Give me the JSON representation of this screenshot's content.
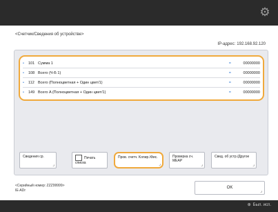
{
  "header": {
    "settings_icon": "gear-icon"
  },
  "breadcrumb": "<Счетчик/Сведения об устройстве>",
  "ip": {
    "label": "IP-адрес:",
    "value": "192.168.92.120"
  },
  "counters": [
    {
      "code": "101",
      "name": "Сумма 1",
      "value": "00000000"
    },
    {
      "code": "108",
      "name": "Всего (Ч-Б 1)",
      "value": "00000000"
    },
    {
      "code": "112",
      "name": "Всего (Полноцветная + Один цвет/1)",
      "value": "00000000"
    },
    {
      "code": "149",
      "name": "Всего A (Полноцветная + Один цвет/1)",
      "value": "00000000"
    }
  ],
  "buttons": {
    "serial": "Сведения ср.",
    "print_list": "Печать списка",
    "check_counter": "Пров. счетч. Kопир./Фис.",
    "check_mib": "Проверка сч. MEAP",
    "device_info": "Свед. об устр./Другое"
  },
  "footer": {
    "serial_label": "<Серийный номер: ZZZ99999>",
    "line2": "IE-ADr"
  },
  "ok_label": "OK",
  "status": {
    "label": "Был. исп."
  }
}
